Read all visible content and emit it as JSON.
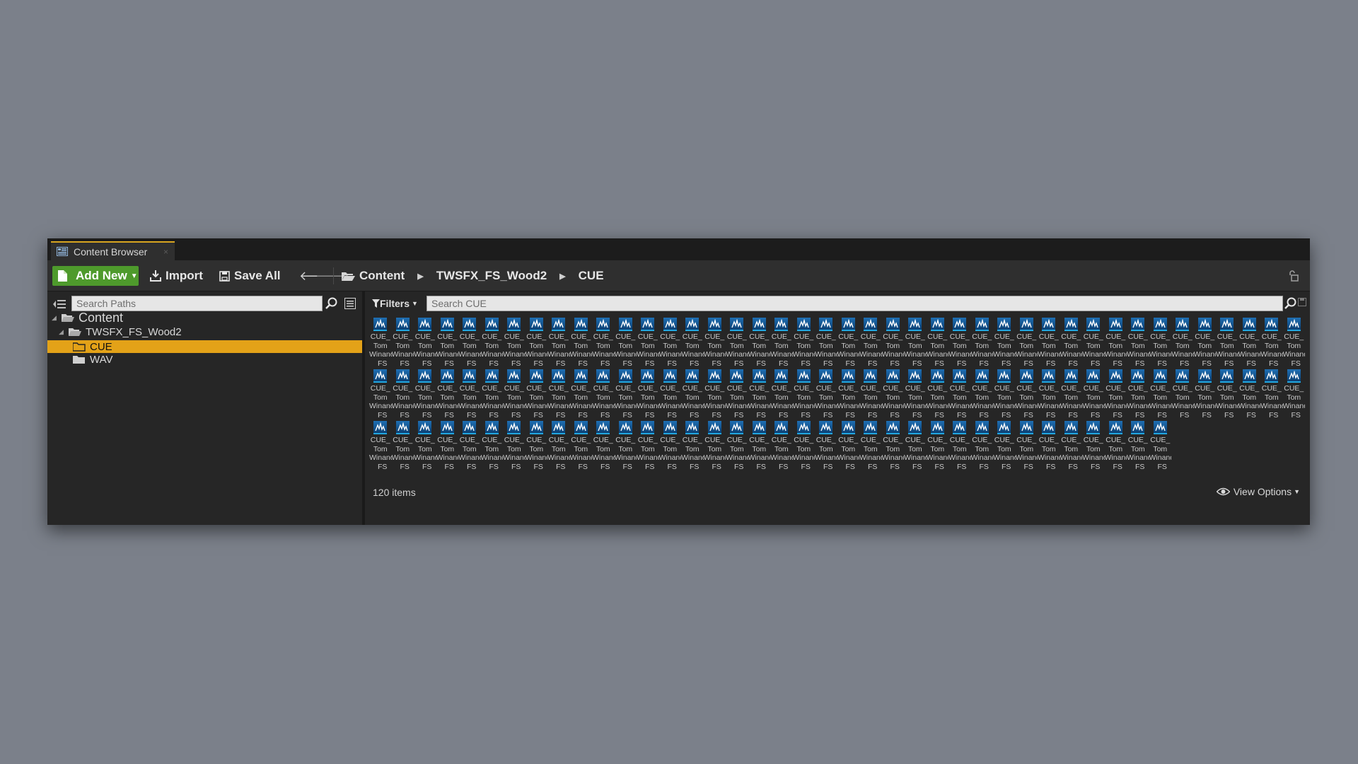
{
  "tab": {
    "title": "Content Browser",
    "close": "×"
  },
  "toolbar": {
    "add_new": "Add New",
    "import": "Import",
    "save_all": "Save All"
  },
  "breadcrumb": [
    "Content",
    "TWSFX_FS_Wood2",
    "CUE"
  ],
  "paths": {
    "search_placeholder": "Search Paths",
    "tree": [
      {
        "label": "Content",
        "level": 0,
        "expanded": true
      },
      {
        "label": "TWSFX_FS_Wood2",
        "level": 1,
        "expanded": true
      },
      {
        "label": "CUE",
        "level": 2,
        "selected": true
      },
      {
        "label": "WAV",
        "level": 2
      }
    ]
  },
  "assets": {
    "filters_label": "Filters",
    "search_placeholder": "Search CUE",
    "item_count": "120 items",
    "view_options": "View Options",
    "tile_label": "CUE_\nTom\nWinand\n_FS",
    "tile_total": 120
  },
  "colors": {
    "selection": "#e3a218",
    "add_new_green": "#4e9a2c",
    "panel_bg": "#262626",
    "toolbar_bg": "#2f2f2f"
  }
}
